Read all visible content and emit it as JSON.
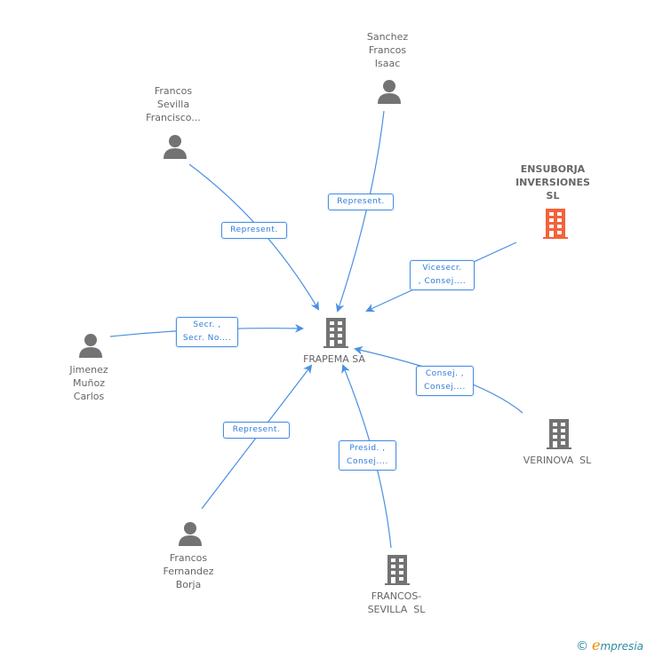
{
  "colors": {
    "edge": "#4a90e2",
    "company": "#737373",
    "person": "#737373",
    "highlight": "#f4623a"
  },
  "center": {
    "name": "FRAPEMA SA",
    "icon": "building-icon"
  },
  "nodes": {
    "sanchez": {
      "lines": [
        "Sanchez",
        "Francos",
        "Isaac"
      ],
      "icon": "person-icon"
    },
    "francos_sevilla_francisco": {
      "lines": [
        "Francos",
        "Sevilla",
        "Francisco..."
      ],
      "icon": "person-icon"
    },
    "ensuborja": {
      "lines": [
        "ENSUBORJA",
        "INVERSIONES",
        "SL"
      ],
      "icon": "building-icon"
    },
    "jimenez": {
      "lines": [
        "Jimenez",
        "Muñoz",
        "Carlos"
      ],
      "icon": "person-icon"
    },
    "verinova": {
      "lines": [
        "VERINOVA  SL"
      ],
      "icon": "building-icon"
    },
    "fernandez": {
      "lines": [
        "Francos",
        "Fernandez",
        "Borja"
      ],
      "icon": "person-icon"
    },
    "francos_sevilla_sl": {
      "lines": [
        "FRANCOS-",
        "SEVILLA  SL"
      ],
      "icon": "building-icon"
    }
  },
  "edges": {
    "sanchez": [
      "Represent."
    ],
    "francos_sevilla_francisco": [
      "Represent."
    ],
    "ensuborja": [
      "Vicesecr.",
      ", Consej...."
    ],
    "jimenez": [
      "Secr. ,",
      "Secr. No...."
    ],
    "verinova": [
      "Consej. ,",
      "Consej...."
    ],
    "fernandez": [
      "Represent."
    ],
    "francos_sevilla_sl": [
      "Presid. ,",
      "Consej...."
    ]
  },
  "footer": {
    "copyright": "©",
    "brand_initial": "e",
    "brand_rest": "mpresia"
  }
}
